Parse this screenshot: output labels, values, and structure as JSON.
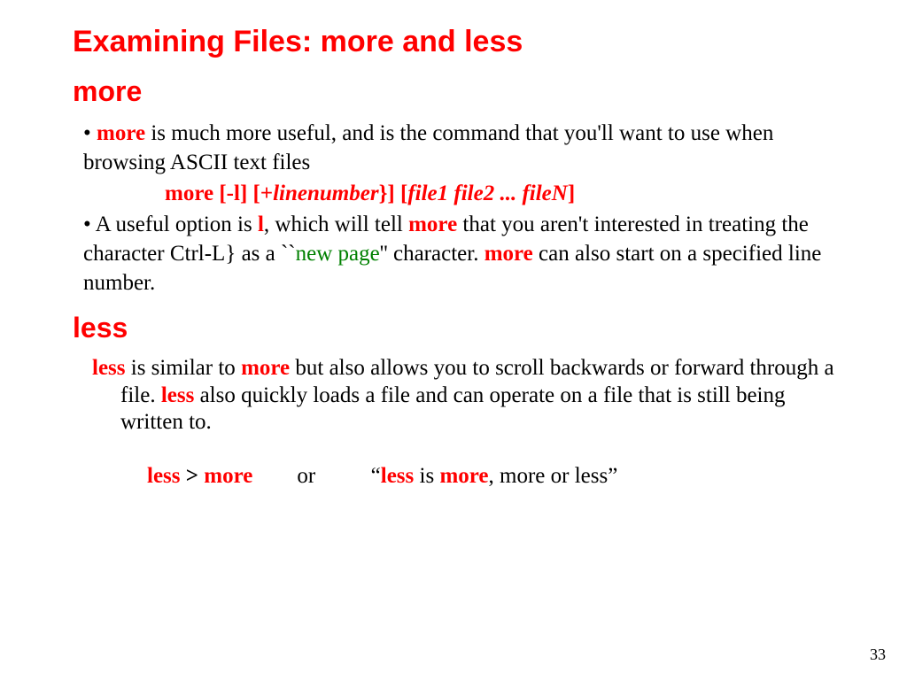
{
  "title": "Examining Files: more and less",
  "more": {
    "heading": "more",
    "bullet1": {
      "dot": "• ",
      "cmd": "more",
      "rest": " is much more useful, and is the command that you'll want to use when browsing ASCII text files"
    },
    "syntax": {
      "s1": "more",
      "s2": " [",
      "s3": "-l",
      "s4": "] [",
      "s5": "+",
      "s6": "linenumber",
      "s7": "}] [",
      "s8": "file1 file2 ... fileN",
      "s9": "]"
    },
    "bullet2": {
      "p1": "• A useful option is  ",
      "opt": "l",
      "p2": ", which will tell  ",
      "cmd": "more",
      "p3": " that you aren't interested in treating the character  Ctrl-L} as a ``",
      "np": "new page",
      "p4": "'' character.  ",
      "cmd2": "more",
      "p5": " can also start on a specified line number."
    }
  },
  "less": {
    "heading": "less",
    "para": {
      "w1": "less",
      "p1": " is similar to ",
      "w2": "more",
      "p2": " but also allows you to scroll backwards or forward through a file. ",
      "w3": "less",
      "p3": " also quickly loads a file and can operate on a file that is still being written to."
    },
    "quip": {
      "q1": "less",
      "q2": " > ",
      "q3": "more",
      "gap": "        ",
      "or": "or",
      "gap2": "          ",
      "oq": "“",
      "q4": "less",
      "q5": " is ",
      "q6": "more",
      "q7": ", more or less”"
    }
  },
  "page": "33"
}
